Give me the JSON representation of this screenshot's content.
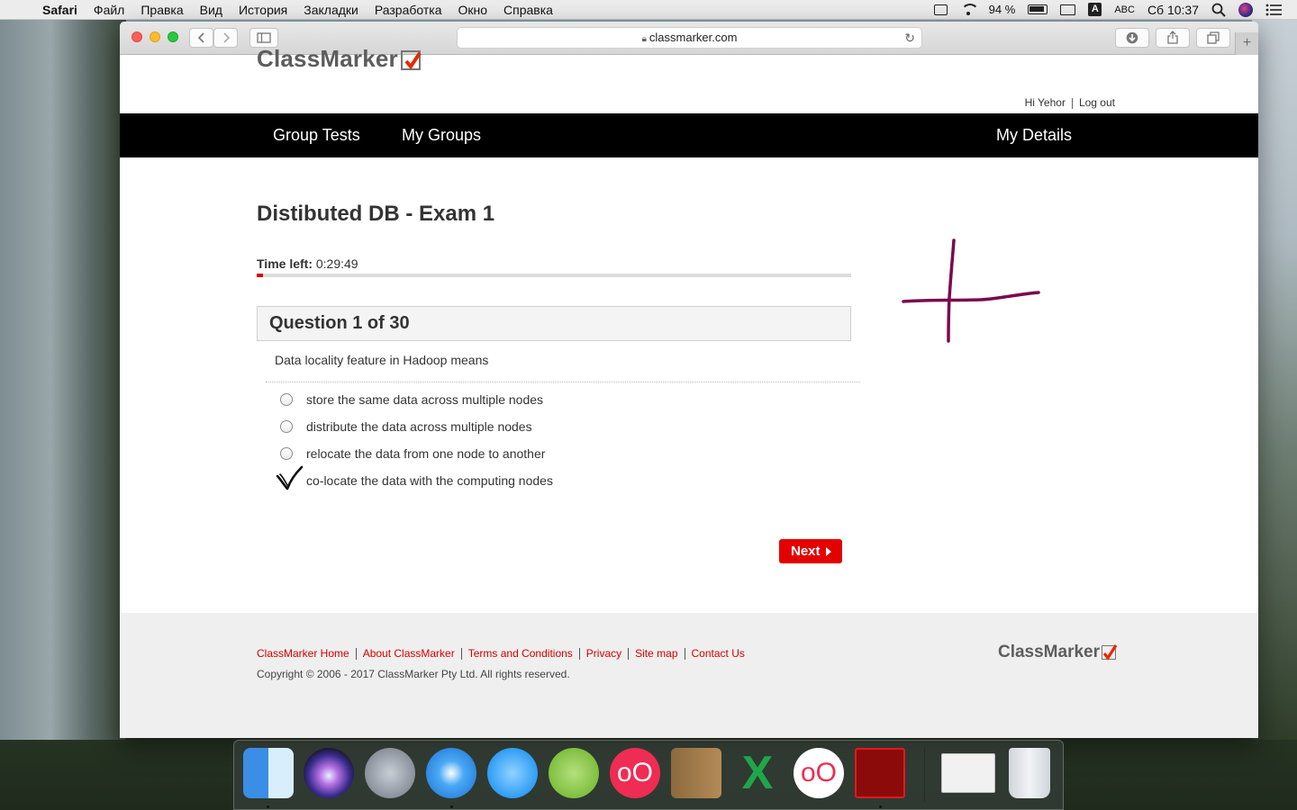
{
  "menubar": {
    "app_name": "Safari",
    "items": [
      "Файл",
      "Правка",
      "Вид",
      "История",
      "Закладки",
      "Разработка",
      "Окно",
      "Справка"
    ],
    "battery": "94 %",
    "input_source": "ABC",
    "input_badge": "A",
    "clock": "Сб 10:37"
  },
  "browser": {
    "url": "classmarker.com"
  },
  "header": {
    "logo": "ClassMarker",
    "greeting": "Hi Yehor",
    "logout": "Log out"
  },
  "nav": {
    "group_tests": "Group Tests",
    "my_groups": "My Groups",
    "my_details": "My Details"
  },
  "exam": {
    "title": "Distibuted DB - Exam 1",
    "time_left_label": "Time left:",
    "time_left_value": "0:29:49",
    "time_progress_fraction": 0.01,
    "question_header": "Question 1 of 30",
    "question_text": "Data locality feature in Hadoop means",
    "options": [
      "store the same data across multiple nodes",
      "distribute the data across multiple nodes",
      "relocate the data from one node to another",
      "co-locate the data with the computing nodes"
    ],
    "next_label": "Next"
  },
  "footer": {
    "links": [
      "ClassMarker Home",
      "About ClassMarker",
      "Terms and Conditions",
      "Privacy",
      "Site map",
      "Contact Us"
    ],
    "copyright": "Copyright © 2006 - 2017 ClassMarker Pty Ltd. All rights reserved.",
    "logo": "ClassMarker"
  },
  "colors": {
    "accent_red": "#e30000",
    "nav_bg": "#000000",
    "annotation_purple": "#7a0a4e"
  },
  "dock": {
    "apps": [
      "finder-icon",
      "siri-icon",
      "launchpad-icon",
      "safari-icon",
      "messages-icon",
      "android-studio-icon",
      "oo-red-icon",
      "contacts-icon",
      "excel-icon",
      "oo-white-icon",
      "acrobat-icon",
      "preview-window-icon",
      "trash-icon"
    ]
  }
}
